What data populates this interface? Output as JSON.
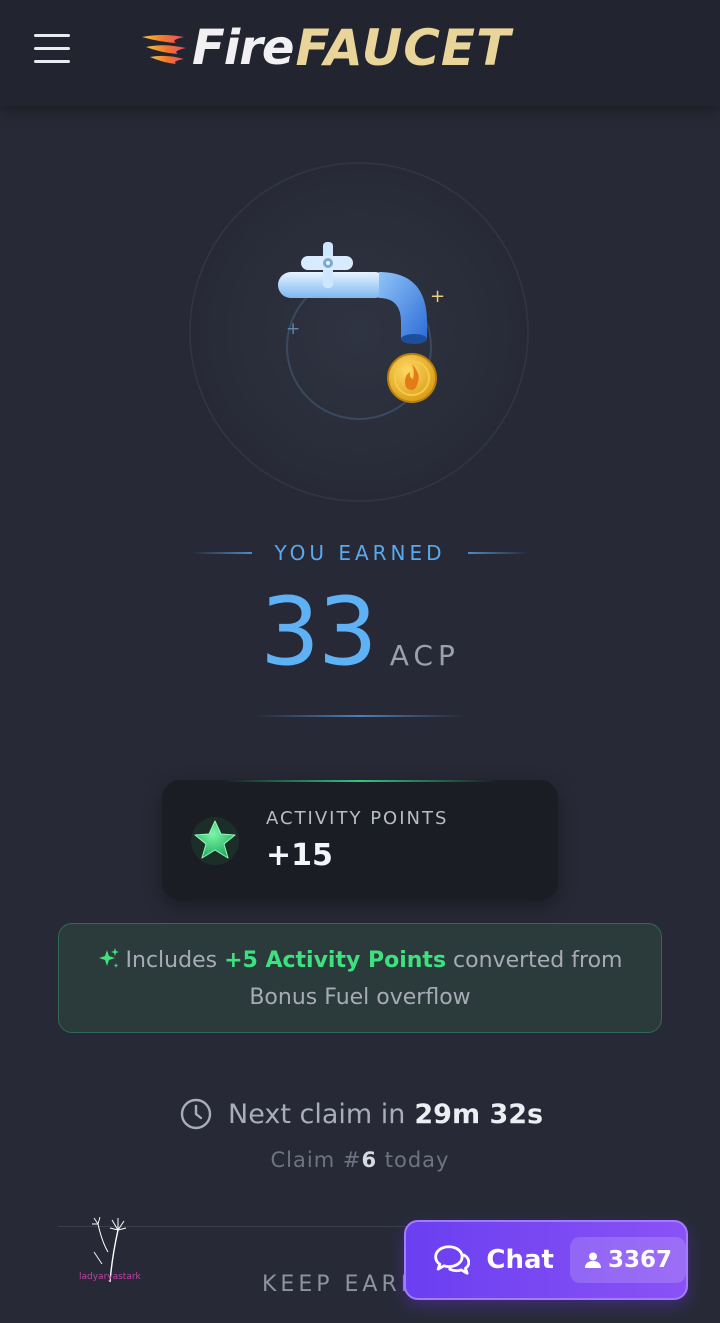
{
  "header": {
    "logo_part1": "Fire",
    "logo_part2": "FAUCET"
  },
  "earned": {
    "label": "YOU EARNED",
    "amount": "33",
    "unit": "ACP"
  },
  "activity": {
    "label": "ACTIVITY POINTS",
    "value": "+15"
  },
  "notice": {
    "prefix": "Includes",
    "highlight": "+5 Activity Points",
    "suffix": "converted from",
    "line2": "Bonus Fuel overflow"
  },
  "next_claim": {
    "label": "Next claim in",
    "time": "29m 32s"
  },
  "claim_count": {
    "prefix": "Claim #",
    "number": "6",
    "suffix": "today"
  },
  "keep_earning": "KEEP EARN",
  "watermark": "ladyaryastark",
  "chat": {
    "label": "Chat",
    "count": "3367"
  },
  "colors": {
    "background": "#272a36",
    "accent_blue": "#5fb1f5",
    "accent_green": "#3fe07f",
    "chat_purple": "#7b4af3",
    "logo_gold": "#e9d49a"
  },
  "icons": [
    "menu-icon",
    "flame-logo-icon",
    "faucet-icon",
    "fire-coin-icon",
    "star-icon",
    "sparkle-icon",
    "clock-icon",
    "chat-bubbles-icon",
    "user-icon"
  ]
}
